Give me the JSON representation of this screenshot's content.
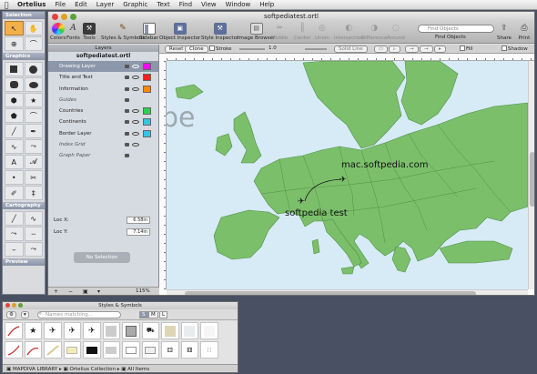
{
  "menubar": {
    "apple": "",
    "items": [
      "Ortelius",
      "File",
      "Edit",
      "Layer",
      "Graphic",
      "Text",
      "Find",
      "View",
      "Window",
      "Help"
    ]
  },
  "palette": {
    "sections": [
      "Selection",
      "Graphics",
      "Cartography",
      "Preview"
    ]
  },
  "window": {
    "title": "softpediatest.ortl",
    "toolbar": {
      "colors": "Colors",
      "fonts": "Fonts",
      "tools": "Tools",
      "styles": "Styles & Symbols",
      "sidebar": "Sidebar",
      "object_inspector": "Object Inspector",
      "style_inspector": "Style Inspector",
      "image_browser": "Image Browser",
      "middle": "Middle",
      "center": "Center",
      "union": "Union",
      "intersection": "Intersection",
      "difference": "Difference",
      "around": "Around",
      "search_placeholder": "Find Objects",
      "find_objects": "Find Objects",
      "share": "Share",
      "print": "Print"
    },
    "options": {
      "reset": "Reset",
      "clone": "Clone",
      "stroke": "Stroke",
      "stroke_width": "1.0",
      "solid_line": "Solid Line",
      "fill": "Fill",
      "shadow": "Shadow"
    }
  },
  "layers": {
    "header": "Layers",
    "document": "softpediatest.ortl",
    "rows": [
      {
        "name": "Drawing Layer",
        "color": "#ff00ff"
      },
      {
        "name": "Title and Text",
        "color": "#ff2020"
      },
      {
        "name": "Information",
        "color": "#ff8800"
      },
      {
        "name": "Guides",
        "color": ""
      },
      {
        "name": "Countries",
        "color": "#33cc55"
      },
      {
        "name": "Continents",
        "color": "#33c6e0"
      },
      {
        "name": "Border Layer",
        "color": "#33c6e0"
      },
      {
        "name": "Index Grid",
        "color": ""
      },
      {
        "name": "Graph Paper",
        "color": ""
      }
    ],
    "loc_x_label": "Loc X:",
    "loc_x": "6.58in",
    "loc_y_label": "Loc Y:",
    "loc_y": "7.14in",
    "no_selection": "No Selection",
    "zoom": "115%"
  },
  "map": {
    "ghost_text": "pe",
    "label_domain": "mac.softpedia.com",
    "label_test": "softpedia test",
    "land_color": "#7cbf6b",
    "sea_color": "#d6ebf5"
  },
  "styles_panel": {
    "title": "Styles & Symbols",
    "search_placeholder": "Names matching...",
    "size_s": "S",
    "size_m": "M",
    "size_l": "L",
    "footer_library": "MAPDIVA LIBRARY",
    "footer_collection": "Ortelius Collection",
    "footer_items": "All Items"
  }
}
